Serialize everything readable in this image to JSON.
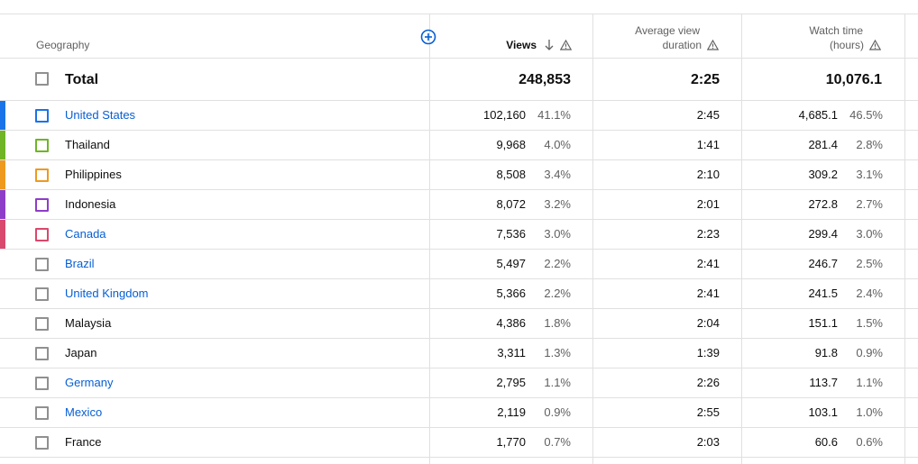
{
  "header": {
    "geography": "Geography",
    "views": "Views",
    "avg_line1": "Average view",
    "avg_line2": "duration",
    "watch_line1": "Watch time",
    "watch_line2": "(hours)"
  },
  "total": {
    "label": "Total",
    "views": "248,853",
    "avg_duration": "2:25",
    "watch_time": "10,076.1"
  },
  "rows": [
    {
      "name": "United States",
      "link": true,
      "color": "#1a73e8",
      "views": "102,160",
      "views_pct": "41.1%",
      "avg": "2:45",
      "watch": "4,685.1",
      "watch_pct": "46.5%"
    },
    {
      "name": "Thailand",
      "link": false,
      "color": "#6fb526",
      "views": "9,968",
      "views_pct": "4.0%",
      "avg": "1:41",
      "watch": "281.4",
      "watch_pct": "2.8%"
    },
    {
      "name": "Philippines",
      "link": false,
      "color": "#ed9a1f",
      "views": "8,508",
      "views_pct": "3.4%",
      "avg": "2:10",
      "watch": "309.2",
      "watch_pct": "3.1%"
    },
    {
      "name": "Indonesia",
      "link": false,
      "color": "#8e3dc8",
      "views": "8,072",
      "views_pct": "3.2%",
      "avg": "2:01",
      "watch": "272.8",
      "watch_pct": "2.7%"
    },
    {
      "name": "Canada",
      "link": true,
      "color": "#d9486d",
      "views": "7,536",
      "views_pct": "3.0%",
      "avg": "2:23",
      "watch": "299.4",
      "watch_pct": "3.0%"
    },
    {
      "name": "Brazil",
      "link": true,
      "color": "",
      "views": "5,497",
      "views_pct": "2.2%",
      "avg": "2:41",
      "watch": "246.7",
      "watch_pct": "2.5%"
    },
    {
      "name": "United Kingdom",
      "link": true,
      "color": "",
      "views": "5,366",
      "views_pct": "2.2%",
      "avg": "2:41",
      "watch": "241.5",
      "watch_pct": "2.4%"
    },
    {
      "name": "Malaysia",
      "link": false,
      "color": "",
      "views": "4,386",
      "views_pct": "1.8%",
      "avg": "2:04",
      "watch": "151.1",
      "watch_pct": "1.5%"
    },
    {
      "name": "Japan",
      "link": false,
      "color": "",
      "views": "3,311",
      "views_pct": "1.3%",
      "avg": "1:39",
      "watch": "91.8",
      "watch_pct": "0.9%"
    },
    {
      "name": "Germany",
      "link": true,
      "color": "",
      "views": "2,795",
      "views_pct": "1.1%",
      "avg": "2:26",
      "watch": "113.7",
      "watch_pct": "1.1%"
    },
    {
      "name": "Mexico",
      "link": true,
      "color": "",
      "views": "2,119",
      "views_pct": "0.9%",
      "avg": "2:55",
      "watch": "103.1",
      "watch_pct": "1.0%"
    },
    {
      "name": "France",
      "link": false,
      "color": "",
      "views": "1,770",
      "views_pct": "0.7%",
      "avg": "2:03",
      "watch": "60.6",
      "watch_pct": "0.6%"
    }
  ],
  "icons": {
    "add_metric": "add-circle-icon",
    "sort": "arrow-down-icon",
    "warning": "warning-triangle-icon"
  }
}
